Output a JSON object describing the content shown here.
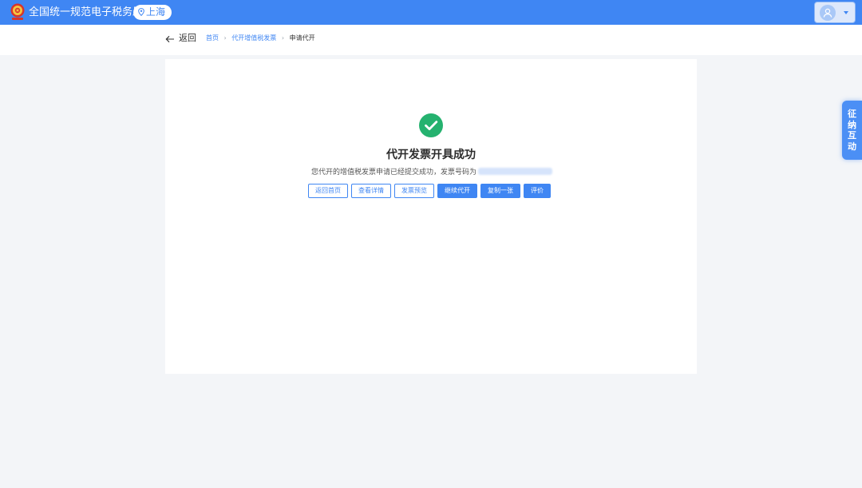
{
  "header": {
    "app_title": "全国统一规范电子税务局",
    "region": "上海"
  },
  "subbar": {
    "back_label": "返回",
    "breadcrumb": [
      "首页",
      "代开增值税发票",
      "申请代开"
    ]
  },
  "result": {
    "title": "代开发票开具成功",
    "message_prefix": "您代开的增值税发票申请已经提交成功，发票号码为",
    "invoice_number": ""
  },
  "actions": [
    {
      "label": "返回首页",
      "style": "outline"
    },
    {
      "label": "查看详情",
      "style": "outline"
    },
    {
      "label": "发票预览",
      "style": "outline"
    },
    {
      "label": "继续代开",
      "style": "solid"
    },
    {
      "label": "复制一张",
      "style": "solid"
    },
    {
      "label": "评价",
      "style": "solid"
    }
  ],
  "side_tab": {
    "label": "征纳互动"
  },
  "colors": {
    "primary": "#3f86f3",
    "success": "#25b26f",
    "page_bg": "#f3f5f8"
  },
  "icons": {
    "emblem": "tax-emblem-icon",
    "location": "location-pin-icon",
    "avatar": "user-avatar-icon",
    "back": "arrow-left-icon",
    "success": "check-circle-icon"
  }
}
